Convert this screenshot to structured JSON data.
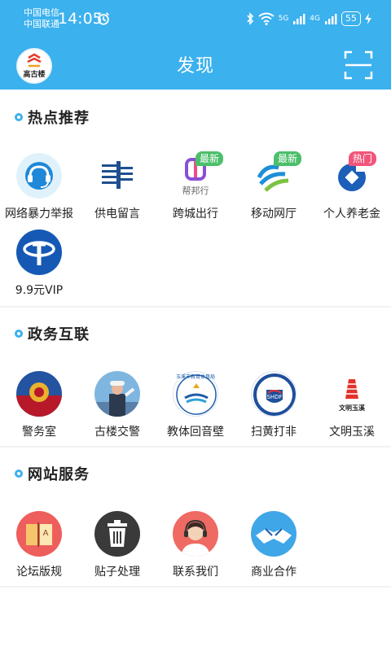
{
  "status": {
    "carrier1": "中国电信",
    "carrier2": "中国联通",
    "time": "14:05",
    "battery": "55",
    "net1": "5G",
    "net2": "4G"
  },
  "header": {
    "title": "发现",
    "avatar_text": "高古楼"
  },
  "sections": [
    {
      "title": "热点推荐",
      "items": [
        {
          "label": "网络暴力举报",
          "icon": "headset-icon"
        },
        {
          "label": "供电留言",
          "icon": "power-grid-icon"
        },
        {
          "label": "跨城出行",
          "icon": "bangbang-icon",
          "badge": "最新",
          "icon_text": "帮邦行"
        },
        {
          "label": "移动网厅",
          "icon": "china-mobile-icon",
          "badge": "最新"
        },
        {
          "label": "个人养老金",
          "icon": "ccb-icon",
          "badge": "热门"
        },
        {
          "label": "9.9元VIP",
          "icon": "china-telecom-icon"
        }
      ]
    },
    {
      "title": "政务互联",
      "items": [
        {
          "label": "警务室",
          "icon": "police-badge-icon"
        },
        {
          "label": "古楼交警",
          "icon": "traffic-police-icon"
        },
        {
          "label": "教体回音壁",
          "icon": "education-seal-icon",
          "icon_text": "玉溪市教育体育局"
        },
        {
          "label": "扫黄打非",
          "icon": "anti-porn-seal-icon"
        },
        {
          "label": "文明玉溪",
          "icon": "civilized-yuxi-icon",
          "icon_text": "文明玉溪"
        }
      ]
    },
    {
      "title": "网站服务",
      "items": [
        {
          "label": "论坛版规",
          "icon": "book-icon"
        },
        {
          "label": "贴子处理",
          "icon": "trash-icon"
        },
        {
          "label": "联系我们",
          "icon": "support-agent-icon"
        },
        {
          "label": "商业合作",
          "icon": "handshake-icon"
        }
      ]
    }
  ],
  "colors": {
    "accent": "#3BB1EE",
    "badge_new": "#4CBF6C",
    "badge_hot": "#F2557A"
  }
}
